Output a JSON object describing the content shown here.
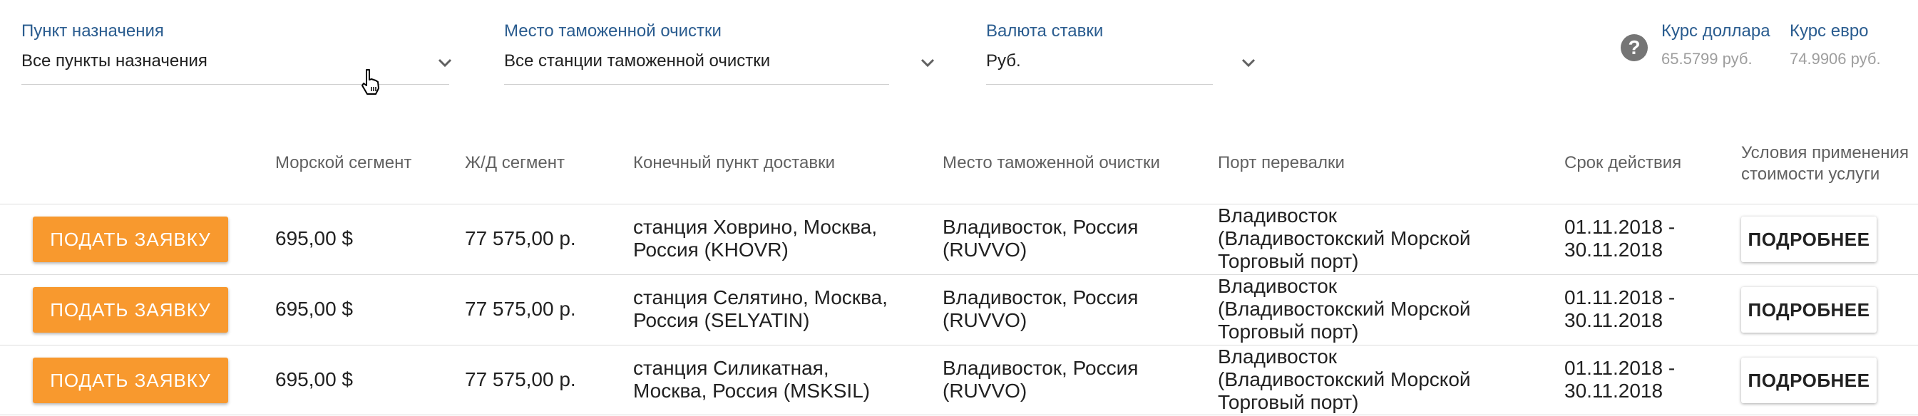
{
  "filters": {
    "destination": {
      "label": "Пункт назначения",
      "value": "Все пункты назначения"
    },
    "customs": {
      "label": "Место таможенной очистки",
      "value": "Все станции таможенной очистки"
    },
    "currency": {
      "label": "Валюта ставки",
      "value": "Руб."
    }
  },
  "rates": {
    "help_glyph": "?",
    "usd": {
      "label": "Курс доллара",
      "value": "65.5799 руб."
    },
    "eur": {
      "label": "Курс евро",
      "value": "74.9906 руб."
    }
  },
  "table": {
    "headers": {
      "sea": "Морской сегмент",
      "rail": "Ж/Д сегмент",
      "final": "Конечный пункт доставки",
      "customs": "Место таможенной очистки",
      "port": "Порт перевалки",
      "validity": "Срок действия",
      "terms": "Условия применения стоимости услуги"
    },
    "apply_label": "ПОДАТЬ ЗАЯВКУ",
    "more_label": "ПОДРОБНЕЕ",
    "rows": [
      {
        "sea": "695,00 $",
        "rail": "77 575,00 р.",
        "final": "станция Ховрино, Москва, Россия (KHOVR)",
        "customs": "Владивосток, Россия (RUVVO)",
        "port": "Владивосток (Владивостокский Морской Торговый порт)",
        "validity": "01.11.2018 - 30.11.2018"
      },
      {
        "sea": "695,00 $",
        "rail": "77 575,00 р.",
        "final": "станция Селятино, Москва, Россия (SELYATIN)",
        "customs": "Владивосток, Россия (RUVVO)",
        "port": "Владивосток (Владивостокский Морской Торговый порт)",
        "validity": "01.11.2018 - 30.11.2018"
      },
      {
        "sea": "695,00 $",
        "rail": "77 575,00 р.",
        "final": "станция Силикатная, Москва, Россия (MSKSIL)",
        "customs": "Владивосток, Россия (RUVVO)",
        "port": "Владивосток (Владивостокский Морской Торговый порт)",
        "validity": "01.11.2018 - 30.11.2018"
      }
    ]
  }
}
